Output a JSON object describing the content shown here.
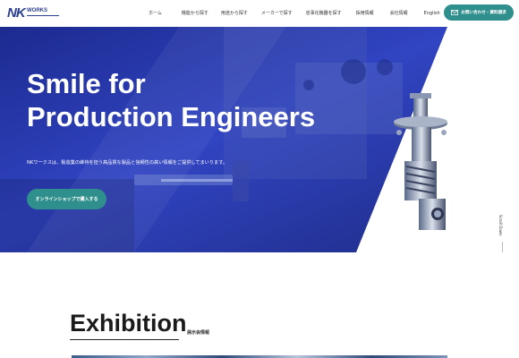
{
  "header": {
    "logo": {
      "mark": "NK",
      "word": "WORKS"
    },
    "nav": [
      {
        "label": "ホーム"
      },
      {
        "label": "機能から探す"
      },
      {
        "label": "用途から探す"
      },
      {
        "label": "メーカーで探す"
      },
      {
        "label": "省事化機器を探す"
      },
      {
        "label": "採用情報"
      },
      {
        "label": "会社情報"
      },
      {
        "label": "English"
      }
    ],
    "contact_button": {
      "label": "お問い合わせ・資料請求",
      "icon": "mail-icon"
    }
  },
  "hero": {
    "title_line1": "Smile for",
    "title_line2": "Production Engineers",
    "subtitle": "NKワークスは、製造業の維持を担う高品質な製品と信頼性の高い情報をご提供してまいります。",
    "shop_button": "オンラインショップで購入する",
    "scroll_label": "Scroll Down"
  },
  "exhibition": {
    "title": "Exhibition",
    "subtitle": "展示会情報"
  },
  "colors": {
    "brand": "#2b3f8f",
    "accent": "#2f8f8c",
    "hero_blue": "#2a3bb5"
  }
}
